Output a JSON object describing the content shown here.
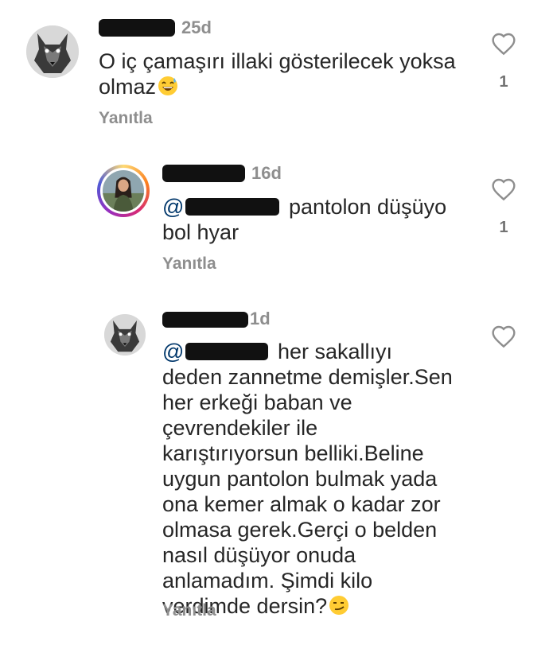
{
  "comments": [
    {
      "time": "25d",
      "text": "O iç çamaşırı illaki gösterilecek yoksa olmaz",
      "emoji": "grinning-sweat-emoji",
      "reply_label": "Yanıtla",
      "like_count": "1"
    },
    {
      "time": "16d",
      "mention_prefix": "@",
      "text": "pantolon düşüyo bol hyar",
      "reply_label": "Yanıtla",
      "like_count": "1"
    },
    {
      "time": "1d",
      "mention_prefix": "@",
      "text": "her sakallıyı deden zannetme demişler.Sen her erkeği baban ve çevrendekiler ile karıştırıyorsun belliki.Beline uygun pantolon bulmak yada ona kemer almak o kadar zor olmasa gerek.Gerçi o belden nasıl düşüyor onuda anlamadım. Şimdi kilo verdimde dersin?",
      "emoji": "smirking-emoji",
      "reply_label": "Yanıtla",
      "like_count": ""
    }
  ],
  "colors": {
    "text": "#262626",
    "secondary": "#8e8e8e",
    "mention": "#00376b"
  }
}
